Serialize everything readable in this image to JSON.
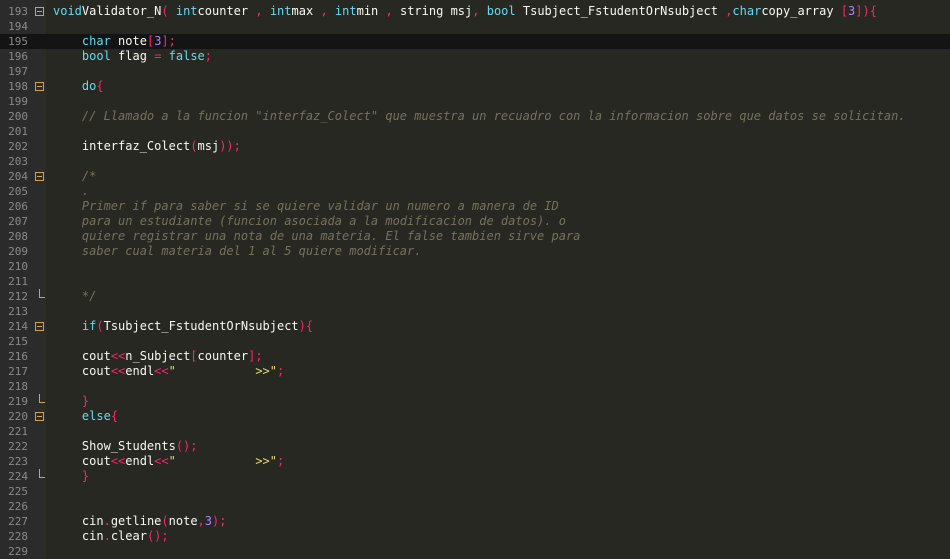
{
  "editor": {
    "current_line_index": 2,
    "lines": [
      {
        "n": "193",
        "fold": "open",
        "segs": [
          [
            "kw",
            "void"
          ],
          [
            "",
            "Validator_N"
          ],
          [
            "op",
            "("
          ],
          [
            "kw",
            "int"
          ],
          [
            "",
            "counter"
          ],
          [
            "op",
            ","
          ],
          [
            "kw",
            "int"
          ],
          [
            "",
            "max"
          ],
          [
            "op",
            ","
          ],
          [
            "kw",
            "int"
          ],
          [
            "",
            "min"
          ],
          [
            "op",
            ","
          ],
          [
            "",
            "string"
          ],
          [
            "",
            "msj"
          ],
          [
            "op",
            ","
          ],
          [
            "kw",
            "bool"
          ],
          [
            "",
            "Tsubject_FstudentOrNsubject"
          ],
          [
            "op",
            ","
          ],
          [
            "kw",
            "char"
          ],
          [
            "",
            "copy_array"
          ],
          [
            "op",
            "["
          ],
          [
            "num",
            "3"
          ],
          [
            "op",
            "]){"
          ]
        ],
        "sp": [
          0,
          0,
          0,
          1,
          0,
          1,
          1,
          0,
          1,
          1,
          0,
          1,
          1,
          1,
          0,
          1,
          1,
          1,
          0,
          0,
          1,
          0,
          0,
          0
        ]
      },
      {
        "n": "194",
        "fold": "",
        "segs": []
      },
      {
        "n": "195",
        "fold": "",
        "segs": [
          [
            "kw",
            "char"
          ],
          [
            "",
            "note"
          ],
          [
            "op",
            "["
          ],
          [
            "num",
            "3"
          ],
          [
            "op",
            "];"
          ]
        ],
        "indent": 4
      },
      {
        "n": "196",
        "fold": "",
        "segs": [
          [
            "kw",
            "bool"
          ],
          [
            "",
            "flag"
          ],
          [
            "op",
            "="
          ],
          [
            "kw",
            "false"
          ],
          [
            "op",
            ";"
          ]
        ],
        "indent": 4
      },
      {
        "n": "197",
        "fold": "",
        "segs": []
      },
      {
        "n": "198",
        "fold": "open",
        "segs": [
          [
            "kw",
            "do"
          ],
          [
            "op",
            "{"
          ]
        ],
        "indent": 4
      },
      {
        "n": "199",
        "fold": "",
        "segs": []
      },
      {
        "n": "200",
        "fold": "",
        "segs": [
          [
            "cm",
            "// Llamado a la funcion \"interfaz_Colect\" que muestra un recuadro con la informacion sobre que datos se solicitan."
          ]
        ],
        "indent": 4
      },
      {
        "n": "201",
        "fold": "",
        "segs": []
      },
      {
        "n": "202",
        "fold": "",
        "segs": [
          [
            "",
            "interfaz_Colect"
          ],
          [
            "op",
            "("
          ],
          [
            "",
            "msj"
          ],
          [
            "op",
            "));"
          ]
        ],
        "indent": 4
      },
      {
        "n": "203",
        "fold": "",
        "segs": []
      },
      {
        "n": "204",
        "fold": "open",
        "segs": [
          [
            "cm",
            "/*"
          ]
        ],
        "indent": 4
      },
      {
        "n": "205",
        "fold": "",
        "segs": [
          [
            "cm",
            "."
          ]
        ],
        "indent": 4
      },
      {
        "n": "206",
        "fold": "",
        "segs": [
          [
            "cm",
            "Primer if para saber si se quiere validar un numero a manera de ID"
          ]
        ],
        "indent": 4
      },
      {
        "n": "207",
        "fold": "",
        "segs": [
          [
            "cm",
            "para un estudiante (funcion asociada a la modificacion de datos). o"
          ]
        ],
        "indent": 4
      },
      {
        "n": "208",
        "fold": "",
        "segs": [
          [
            "cm",
            "quiere registrar una nota de una materia. El false tambien sirve para"
          ]
        ],
        "indent": 4
      },
      {
        "n": "209",
        "fold": "",
        "segs": [
          [
            "cm",
            "saber cual materia del 1 al 5 quiere modificar."
          ]
        ],
        "indent": 4
      },
      {
        "n": "210",
        "fold": "",
        "segs": []
      },
      {
        "n": "211",
        "fold": "",
        "segs": []
      },
      {
        "n": "212",
        "fold": "end",
        "segs": [
          [
            "cm",
            "*/"
          ]
        ],
        "indent": 4
      },
      {
        "n": "213",
        "fold": "",
        "segs": []
      },
      {
        "n": "214",
        "fold": "open",
        "segs": [
          [
            "kw",
            "if"
          ],
          [
            "op",
            "("
          ],
          [
            "",
            "Tsubject_FstudentOrNsubject"
          ],
          [
            "op",
            "){"
          ]
        ],
        "indent": 4
      },
      {
        "n": "215",
        "fold": "",
        "segs": []
      },
      {
        "n": "216",
        "fold": "",
        "segs": [
          [
            "",
            "cout"
          ],
          [
            "op",
            "<<"
          ],
          [
            "",
            "n_Subject"
          ],
          [
            "op",
            "["
          ],
          [
            "",
            "counter"
          ],
          [
            "op",
            "];"
          ]
        ],
        "indent": 4
      },
      {
        "n": "217",
        "fold": "",
        "segs": [
          [
            "",
            "cout"
          ],
          [
            "op",
            "<<"
          ],
          [
            "",
            "endl"
          ],
          [
            "op",
            "<<"
          ],
          [
            "str",
            "\"           >>\""
          ],
          [
            "op",
            ";"
          ]
        ],
        "indent": 4
      },
      {
        "n": "218",
        "fold": "",
        "segs": []
      },
      {
        "n": "219",
        "fold": "end",
        "segs": [
          [
            "op",
            "}"
          ]
        ],
        "indent": 4
      },
      {
        "n": "220",
        "fold": "open",
        "segs": [
          [
            "kw",
            "else"
          ],
          [
            "op",
            "{"
          ]
        ],
        "indent": 4
      },
      {
        "n": "221",
        "fold": "",
        "segs": []
      },
      {
        "n": "222",
        "fold": "",
        "segs": [
          [
            "",
            "Show_Students"
          ],
          [
            "op",
            "();"
          ]
        ],
        "indent": 4
      },
      {
        "n": "223",
        "fold": "",
        "segs": [
          [
            "",
            "cout"
          ],
          [
            "op",
            "<<"
          ],
          [
            "",
            "endl"
          ],
          [
            "op",
            "<<"
          ],
          [
            "str",
            "\"           >>\""
          ],
          [
            "op",
            ";"
          ]
        ],
        "indent": 4
      },
      {
        "n": "224",
        "fold": "end",
        "segs": [
          [
            "op",
            "}"
          ]
        ],
        "indent": 4
      },
      {
        "n": "225",
        "fold": "",
        "segs": []
      },
      {
        "n": "226",
        "fold": "",
        "segs": []
      },
      {
        "n": "227",
        "fold": "",
        "segs": [
          [
            "",
            "cin"
          ],
          [
            "op",
            "."
          ],
          [
            "",
            "getline"
          ],
          [
            "op",
            "("
          ],
          [
            "",
            "note"
          ],
          [
            "op",
            ","
          ],
          [
            "num",
            "3"
          ],
          [
            "op",
            ");"
          ]
        ],
        "indent": 4
      },
      {
        "n": "228",
        "fold": "",
        "segs": [
          [
            "",
            "cin"
          ],
          [
            "op",
            "."
          ],
          [
            "",
            "clear"
          ],
          [
            "op",
            "();"
          ]
        ],
        "indent": 4
      },
      {
        "n": "229",
        "fold": "",
        "segs": []
      }
    ]
  }
}
